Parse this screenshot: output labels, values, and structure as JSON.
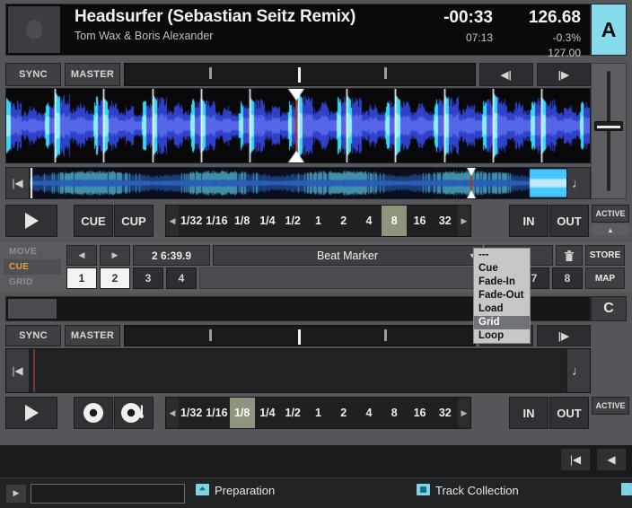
{
  "deckA": {
    "track": {
      "title": "Headsurfer (Sebastian Seitz Remix)",
      "artist": "Tom Wax & Boris Alexander",
      "time_remaining": "-00:33",
      "time_elapsed": "07:13",
      "bpm": "126.68",
      "pitch": "-0.3%",
      "bpm_original": "127.00"
    },
    "deck_letter": "A",
    "deck_color": "#86dcec",
    "sync_label": "SYNC",
    "master_label": "MASTER",
    "nudge_back": "◀|",
    "nudge_fwd": "|▶",
    "transport": {
      "cue_label": "CUE",
      "cup_label": "CUP",
      "in_label": "IN",
      "out_label": "OUT",
      "active_label": "ACTIVE",
      "loop_sizes": [
        "1/32",
        "1/16",
        "1/8",
        "1/4",
        "1/2",
        "1",
        "2",
        "4",
        "8",
        "16",
        "32"
      ],
      "loop_selected": "8",
      "arrow_left": "◀",
      "arrow_right": "▶"
    }
  },
  "cue_panel": {
    "modes": [
      {
        "label": "MOVE",
        "active": false
      },
      {
        "label": "CUE",
        "active": true
      },
      {
        "label": "GRID",
        "active": false
      }
    ],
    "prev_label": "◀",
    "next_label": "▶",
    "cue_position": "2 6:39.9",
    "cue_name": "Beat Marker",
    "cue_type_value": "---",
    "store_label": "STORE",
    "map_label": "MAP",
    "trash_icon": "trash-icon",
    "hotcues": [
      {
        "label": "1",
        "active": true
      },
      {
        "label": "2",
        "active": true
      },
      {
        "label": "3",
        "active": false
      },
      {
        "label": "4",
        "active": false
      },
      {
        "label": "7",
        "active": false
      },
      {
        "label": "8",
        "active": false
      }
    ]
  },
  "dropdown": {
    "items": [
      "---",
      "Cue",
      "Fade-In",
      "Fade-Out",
      "Load",
      "Grid",
      "Loop"
    ],
    "selected": "Grid"
  },
  "deckC": {
    "deck_letter": "C",
    "sync_label": "SYNC",
    "master_label": "MASTER",
    "nudge_back": "◀|",
    "nudge_fwd": "|▶",
    "transport": {
      "in_label": "IN",
      "out_label": "OUT",
      "active_label": "ACTIVE",
      "loop_sizes": [
        "1/32",
        "1/16",
        "1/8",
        "1/4",
        "1/2",
        "1",
        "2",
        "4",
        "8",
        "16",
        "32"
      ],
      "loop_selected": "1/8",
      "arrow_left": "◀",
      "arrow_right": "▶"
    }
  },
  "bottom": {
    "nav_first": "|◀",
    "nav_back": "◀",
    "search_arrow": "▶",
    "search_value": "",
    "search_placeholder": "",
    "tree": [
      {
        "label": "Preparation",
        "icon": "folder-icon"
      },
      {
        "label": "Track Collection",
        "icon": "collection-icon"
      }
    ]
  }
}
